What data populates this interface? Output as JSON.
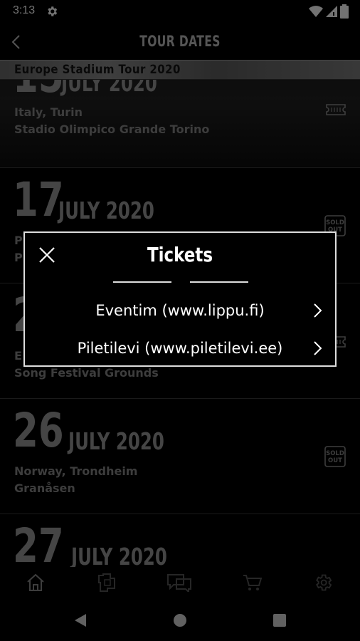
{
  "status": {
    "time": "3:13"
  },
  "header": {
    "title": "TOUR DATES"
  },
  "banner": {
    "text": "Europe Stadium Tour 2020"
  },
  "events": [
    {
      "day": "15",
      "month": "JULY 2020",
      "country": "Italy, Turin",
      "venue": "Stadio Olimpico Grande Torino",
      "status": "ticket"
    },
    {
      "day": "17",
      "month": "JULY 2020",
      "country": "P",
      "venue": "P",
      "status": "sold-out"
    },
    {
      "day": "2",
      "month": "",
      "country": "E",
      "venue": "Song Festival Grounds",
      "status": "ticket"
    },
    {
      "day": "26",
      "month": "JULY 2020",
      "country": "Norway, Trondheim",
      "venue": "Granåsen",
      "status": "sold-out"
    },
    {
      "day": "27",
      "month": "JULY 2020",
      "country": "",
      "venue": "",
      "status": ""
    }
  ],
  "sold_out_label": {
    "line1": "SOLD",
    "line2": "OUT"
  },
  "dialog": {
    "title": "Tickets",
    "options": [
      {
        "label": "Eventim (www.lippu.fi)"
      },
      {
        "label": "Piletilevi (www.piletilevi.ee)"
      }
    ]
  },
  "bottom_nav": [
    "home-icon",
    "band-logo-icon",
    "chat-icon",
    "cart-icon",
    "settings-icon"
  ],
  "colors": {
    "accent": "#9a9a9a",
    "background": "#000000",
    "dialog_border": "#dddddd"
  }
}
